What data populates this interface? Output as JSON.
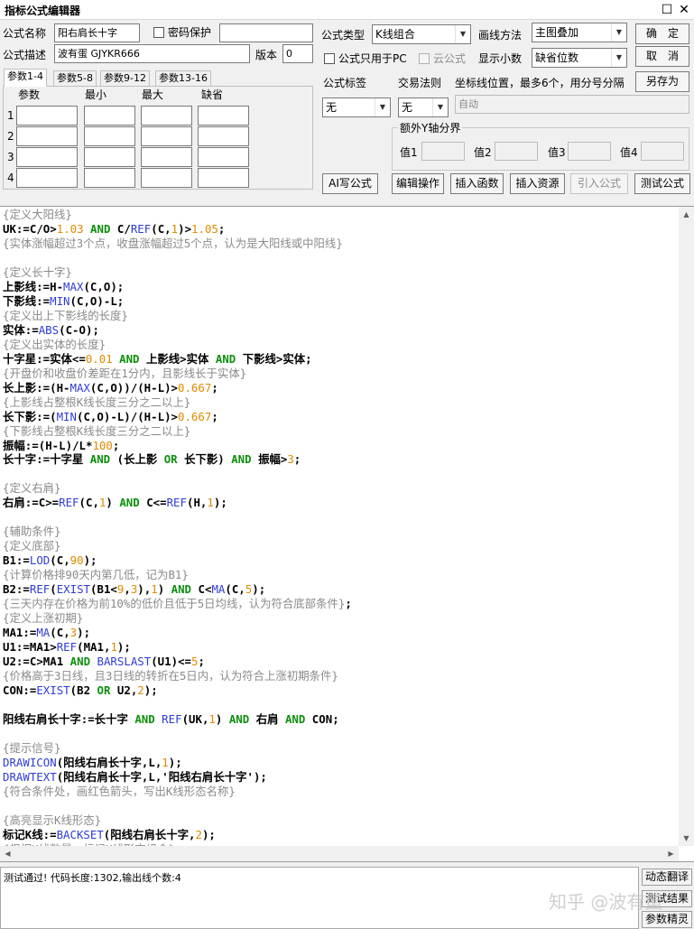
{
  "window": {
    "title": "指标公式编辑器"
  },
  "form": {
    "name_label": "公式名称",
    "name_value": "阳右肩长十字",
    "password_label": "密码保护",
    "desc_label": "公式描述",
    "desc_value": "波有蛋 GJYKR666",
    "version_label": "版本",
    "version_value": "0",
    "type_label": "公式类型",
    "type_value": "K线组合",
    "draw_label": "画线方法",
    "draw_value": "主图叠加",
    "pc_only_label": "公式只用于PC",
    "cloud_label": "云公式",
    "decimals_label": "显示小数",
    "decimals_value": "缺省位数",
    "ok_label": "确　定",
    "cancel_label": "取　消",
    "saveas_label": "另存为"
  },
  "tabs": [
    "参数1-4",
    "参数5-8",
    "参数9-12",
    "参数13-16"
  ],
  "params": {
    "headers": [
      "参数",
      "最小",
      "最大",
      "缺省"
    ],
    "rows": [
      "1",
      "2",
      "3",
      "4"
    ]
  },
  "tags": {
    "tag_label": "公式标签",
    "tag_value": "无",
    "trade_label": "交易法则",
    "trade_value": "无",
    "coord_label": "坐标线位置，最多6个，用分号分隔",
    "coord_value": "自动",
    "yaxis_label": "额外Y轴分界",
    "values": [
      "值1",
      "值2",
      "值3",
      "值4"
    ]
  },
  "toolbar": [
    "AI写公式",
    "编辑操作",
    "插入函数",
    "插入资源",
    "引入公式",
    "测试公式"
  ],
  "code_lines": [
    "{定义大阳线}",
    "UK:=C/O>1.03 AND C/REF(C,1)>1.05;",
    "{实体涨幅超过3个点，收盘涨幅超过5个点，认为是大阳线或中阳线}",
    "",
    "{定义长十字}",
    "上影线:=H-MAX(C,O);",
    "下影线:=MIN(C,O)-L;",
    "{定义出上下影线的长度}",
    "实体:=ABS(C-O);",
    "{定义出实体的长度}",
    "十字星:=实体<=0.01 AND 上影线>实体 AND 下影线>实体;",
    "{开盘价和收盘价差距在1分内，且影线长于实体}",
    "长上影:=(H-MAX(C,O))/(H-L)>0.667;",
    "{上影线占整根K线长度三分之二以上}",
    "长下影:=(MIN(C,O)-L)/(H-L)>0.667;",
    "{下影线占整根K线长度三分之二以上}",
    "振幅:=(H-L)/L*100;",
    "长十字:=十字星 AND (长上影 OR 长下影) AND 振幅>3;",
    "",
    "{定义右肩}",
    "右肩:=C>=REF(C,1) AND C<=REF(H,1);",
    "",
    "{辅助条件}",
    "{定义底部}",
    "B1:=LOD(C,90);",
    "{计算价格排90天内第几低，记为B1}",
    "B2:=REF(EXIST(B1<9,3),1) AND C<MA(C,5);",
    "{三天内存在价格为前10%的低价且低于5日均线，认为符合底部条件};",
    "{定义上涨初期}",
    "MA1:=MA(C,3);",
    "U1:=MA1>REF(MA1,1);",
    "U2:=C>MA1 AND BARSLAST(U1)<=5;",
    "{价格高于3日线，且3日线的转折在5日内，认为符合上涨初期条件}",
    "CON:=EXIST(B2 OR U2,2);",
    "",
    "阳线右肩长十字:=长十字 AND REF(UK,1) AND 右肩 AND CON;",
    "",
    "{提示信号}",
    "DRAWICON(阳线右肩长十字,L,1);",
    "DRAWTEXT(阳线右肩长十字,L,'阳线右肩长十字');",
    "{符合条件处，画红色箭头，写出K线形态名称}",
    "",
    "{高亮显示K线形态}",
    "标记K线:=BACKSET(阳线右肩长十字,2);",
    "{根据K线数量，标记K线形态组合}"
  ],
  "status": {
    "text": "测试通过! 代码长度:1302,输出线个数:4",
    "buttons": [
      "动态翻译",
      "测试结果",
      "参数精灵"
    ]
  },
  "watermark": "知乎 @波有蛋",
  "colors": {
    "comment": "#8a8a8a",
    "keyword": "#0d8f0d",
    "function": "#2e3bd6",
    "number": "#e08a00"
  }
}
